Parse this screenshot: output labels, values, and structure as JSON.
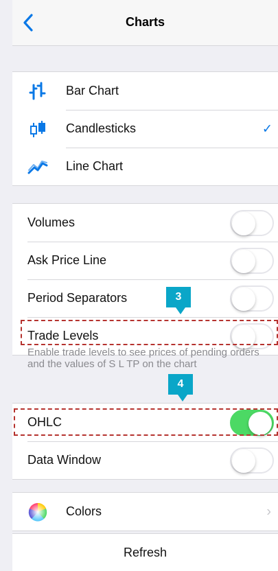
{
  "header": {
    "title": "Charts"
  },
  "chart_types": [
    {
      "label": "Bar Chart",
      "icon": "bar-chart-icon",
      "selected": false
    },
    {
      "label": "Candlesticks",
      "icon": "candlesticks-icon",
      "selected": true
    },
    {
      "label": "Line Chart",
      "icon": "line-chart-icon",
      "selected": false
    }
  ],
  "options": [
    {
      "label": "Volumes",
      "on": false
    },
    {
      "label": "Ask Price Line",
      "on": false
    },
    {
      "label": "Period Separators",
      "on": false
    },
    {
      "label": "Trade Levels",
      "on": false
    }
  ],
  "trade_levels_note": "Enable trade levels to see prices of pending orders and the values of S L TP on the chart",
  "options2": [
    {
      "label": "OHLC",
      "on": true
    },
    {
      "label": "Data Window",
      "on": false
    }
  ],
  "colors_row": {
    "label": "Colors",
    "icon": "color-wheel-icon"
  },
  "refresh_label": "Refresh",
  "annotations": {
    "badge3": "3",
    "badge4": "4"
  },
  "colors": {
    "accent": "#0a78e6",
    "toggle_on": "#4cd964",
    "badge": "#0aa6c8",
    "dash": "#b5322e"
  }
}
